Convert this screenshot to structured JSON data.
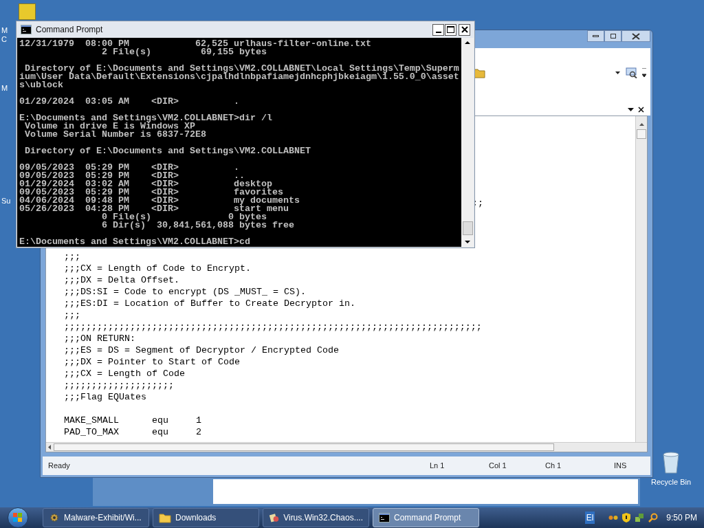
{
  "desktop": {
    "partial_labels": [
      "M",
      "C",
      "M",
      "Su"
    ],
    "icons": [
      {
        "label": "Recycle Bin"
      }
    ]
  },
  "editor": {
    "fragment": ";;",
    "blocks": [
      [
        ";;;",
        ";;;CX = Length of Code to Encrypt.",
        ";;;DX = Delta Offset.",
        ";;;DS:SI = Code to encrypt (DS _MUST_ = CS).",
        ";;;ES:DI = Location of Buffer to Create Decryptor in.",
        ";;;",
        ";;;;;;;;;;;;;;;;;;;;;;;;;;;;;;;;;;;;;;;;;;;;;;;;;;;;;;;;;;;;;;;;;;;;;;;;;;;;",
        ";;;ON RETURN:",
        ";;;ES = DS = Segment of Decryptor / Encrypted Code",
        ";;;DX = Pointer to Start of Code",
        ";;;CX = Length of Code",
        ";;;;;;;;;;;;;;;;;;;;",
        ";;;Flag EQUates"
      ],
      [
        "MAKE_SMALL      equ     1",
        "PAD_TO_MAX      equ     2"
      ]
    ],
    "status": {
      "state": "Ready",
      "line": "Ln 1",
      "col": "Col 1",
      "ch": "Ch 1",
      "mode": "INS"
    }
  },
  "cmd": {
    "title": "Command Prompt",
    "blocks": [
      [
        "12/31/1979  08:00 PM            62,525 urlhaus-filter-online.txt",
        "               2 File(s)         69,155 bytes"
      ],
      [
        " Directory of E:\\Documents and Settings\\VM2.COLLABNET\\Local Settings\\Temp\\Superm",
        "ium\\User Data\\Default\\Extensions\\cjpalhdlnbpafiamejdnhcphjbkeiagm\\1.55.0_0\\asset",
        "s\\ublock"
      ],
      [
        "01/29/2024  03:05 AM    <DIR>          ."
      ],
      [
        "E:\\Documents and Settings\\VM2.COLLABNET>dir /l",
        " Volume in drive E is Windows XP",
        " Volume Serial Number is 6837-72E8"
      ],
      [
        " Directory of E:\\Documents and Settings\\VM2.COLLABNET"
      ],
      [
        "09/05/2023  05:29 PM    <DIR>          .",
        "09/05/2023  05:29 PM    <DIR>          ..",
        "01/29/2024  03:02 AM    <DIR>          desktop",
        "09/05/2023  05:29 PM    <DIR>          favorites",
        "04/06/2024  09:48 PM    <DIR>          my documents",
        "05/26/2023  04:28 PM    <DIR>          start menu",
        "               0 File(s)              0 bytes",
        "               6 Dir(s)  30,841,561,088 bytes free"
      ],
      [
        "E:\\Documents and Settings\\VM2.COLLABNET>cd"
      ]
    ]
  },
  "taskbar": {
    "buttons": [
      {
        "label": "Malware-Exhibit/Wi...",
        "kind": "browser",
        "selected": false
      },
      {
        "label": "Downloads",
        "kind": "folder",
        "selected": false
      },
      {
        "label": "Virus.Win32.Chaos....",
        "kind": "file",
        "selected": false
      },
      {
        "label": "Command Prompt",
        "kind": "console",
        "selected": true
      }
    ],
    "language": "El",
    "clock": "9:50 PM"
  }
}
